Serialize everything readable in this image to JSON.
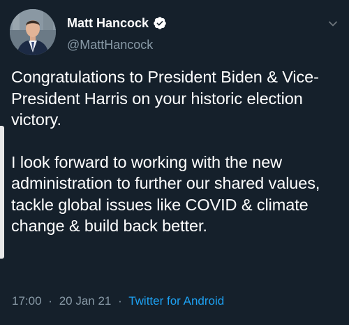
{
  "author": {
    "display_name": "Matt Hancock",
    "handle": "@MattHancock",
    "verified": true,
    "avatar_icon": "user-photo"
  },
  "tweet": {
    "paragraphs": [
      "Congratulations to President Biden & Vice-President Harris on your historic election victory.",
      "I look forward to working with the new administration to further our shared values, tackle global issues like COVID & climate change & build back better."
    ]
  },
  "meta": {
    "time": "17:00",
    "separator": "·",
    "date": "20 Jan 21",
    "source": "Twitter for Android"
  },
  "icons": {
    "verified": "verified-badge-icon",
    "menu": "chevron-down-icon"
  },
  "colors": {
    "background": "#15202b",
    "text": "#ffffff",
    "secondary_text": "#8899a6",
    "link": "#1da1f2"
  }
}
